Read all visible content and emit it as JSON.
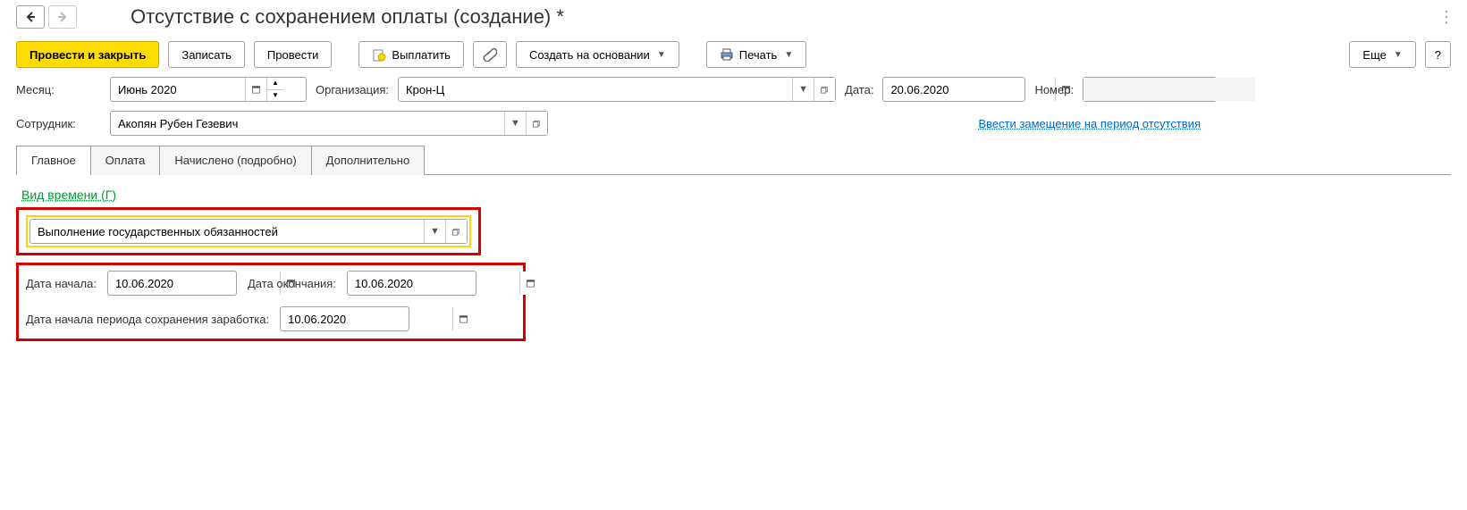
{
  "header": {
    "title": "Отсутствие с сохранением оплаты (создание) *"
  },
  "toolbar": {
    "post_and_close": "Провести и закрыть",
    "write": "Записать",
    "post": "Провести",
    "pay": "Выплатить",
    "create_based": "Создать на основании",
    "print": "Печать",
    "more": "Еще",
    "help": "?"
  },
  "fields": {
    "month_label": "Месяц:",
    "month_value": "Июнь 2020",
    "org_label": "Организация:",
    "org_value": "Крон-Ц",
    "date_label": "Дата:",
    "date_value": "20.06.2020",
    "number_label": "Номер:",
    "number_value": "",
    "employee_label": "Сотрудник:",
    "employee_value": "Акопян Рубен Гезевич",
    "substitution_link": "Ввести замещение на период отсутствия"
  },
  "tabs": {
    "main": "Главное",
    "payment": "Оплата",
    "accrued": "Начислено (подробно)",
    "extra": "Дополнительно"
  },
  "main_tab": {
    "time_type_label": "Вид времени (Г)",
    "time_type_value": "Выполнение государственных обязанностей",
    "start_label": "Дата начала:",
    "start_value": "10.06.2020",
    "end_label": "Дата окончания:",
    "end_value": "10.06.2020",
    "period_start_label": "Дата начала периода сохранения заработка:",
    "period_start_value": "10.06.2020"
  }
}
